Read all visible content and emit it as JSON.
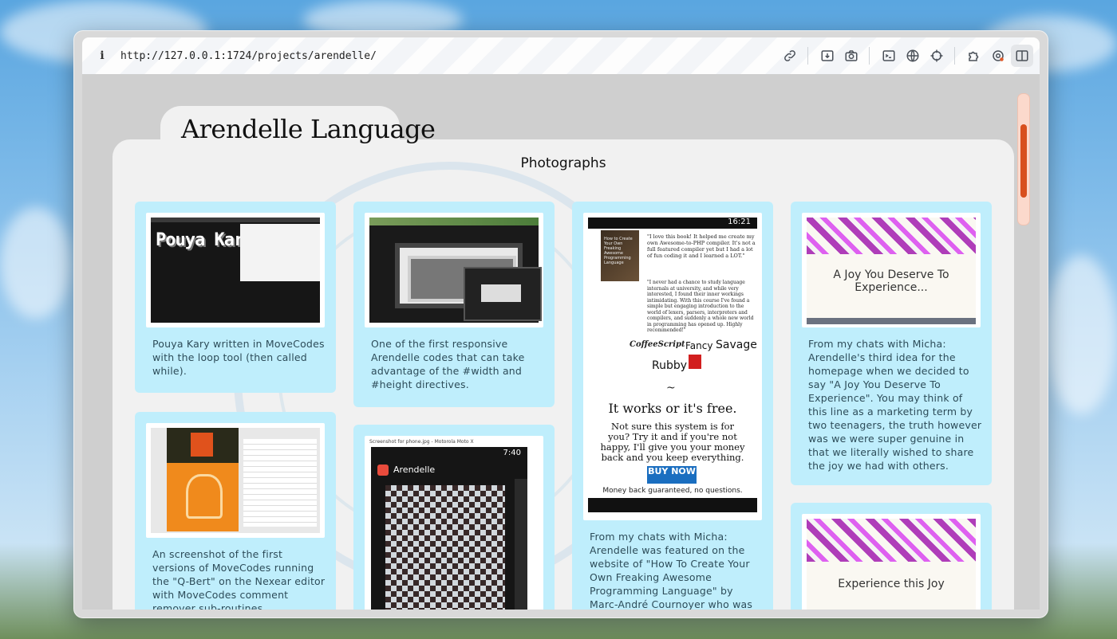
{
  "browser": {
    "url": "http://127.0.0.1:1724/projects/arendelle/"
  },
  "page": {
    "title": "Arendelle Language",
    "section": "Photographs"
  },
  "cards": [
    {
      "caption": "Pouya Kary written in MoveCodes with the loop tool (then called while).",
      "photo_text": "Pouya Kary"
    },
    {
      "caption": "One of the first responsive Arendelle codes that can take advantage of the #width and #height directives."
    },
    {
      "caption": "From my chats with Micha: Arendelle was featured on the website of \"How To Create Your Own Freaking Awesome Programming Language\" by Marc-André Cournoyer who was",
      "photo": {
        "status_time": "16:21",
        "book_title": "How to Create Your Own Freaking Awesome Programming Language",
        "quote1": "\"I love this book! It helped me create my own Awesome-to-PHP compiler. It's not a full featured compiler yet but I had a lot of fun coding it and I learned a LOT.\"",
        "quote2": "\"I never had a chance to study language internals at university, and while very interested, I found their inner workings intimidating. With this course I've found a simple but engaging introduction to the world of lexers, parsers, interpreters and compilers, and suddenly a whole new world in programming has opened up. Highly recommended!\"",
        "langs": [
          "CoffeeScript",
          "Fancy",
          "Savage",
          "Rubby"
        ],
        "headline": "It works or it's free.",
        "body": "Not sure this system is for you? Try it and if you're not happy, I'll give you your money back and you keep everything.",
        "buy": "BUY NOW",
        "guarantee": "Money back guaranteed, no questions."
      }
    },
    {
      "caption": "From my chats with Micha: Arendelle's third idea for the homepage when we decided to say \"A Joy You Deserve To Experience\". You may think of this line as a marketing term by two teenagers, the truth however was we were super genuine in that we literally wished to share the joy we had with others.",
      "photo_text": "A Joy You Deserve To Experience..."
    },
    {
      "caption": "An screenshot of the first versions of MoveCodes running the \"Q-Bert\" on the Nexear editor with MoveCodes comment remover sub-routines."
    },
    {
      "photo": {
        "window_title": "Screenshot for phone.jpg - Motorola Moto X",
        "time": "7:40",
        "app": "Arendelle"
      }
    },
    {
      "photo_text": "Experience this Joy"
    }
  ],
  "icons": {
    "info": "info-icon",
    "link": "link-icon",
    "download": "download-icon",
    "camera": "camera-icon",
    "terminal": "terminal-icon",
    "globe": "globe-icon",
    "crosshair": "crosshair-icon",
    "extension": "extension-icon",
    "shield": "shield-icon",
    "split": "split-view-icon"
  },
  "colors": {
    "card": "#bfeefc",
    "caption": "#2d4c59",
    "scroll_thumb": "#d8501e"
  }
}
